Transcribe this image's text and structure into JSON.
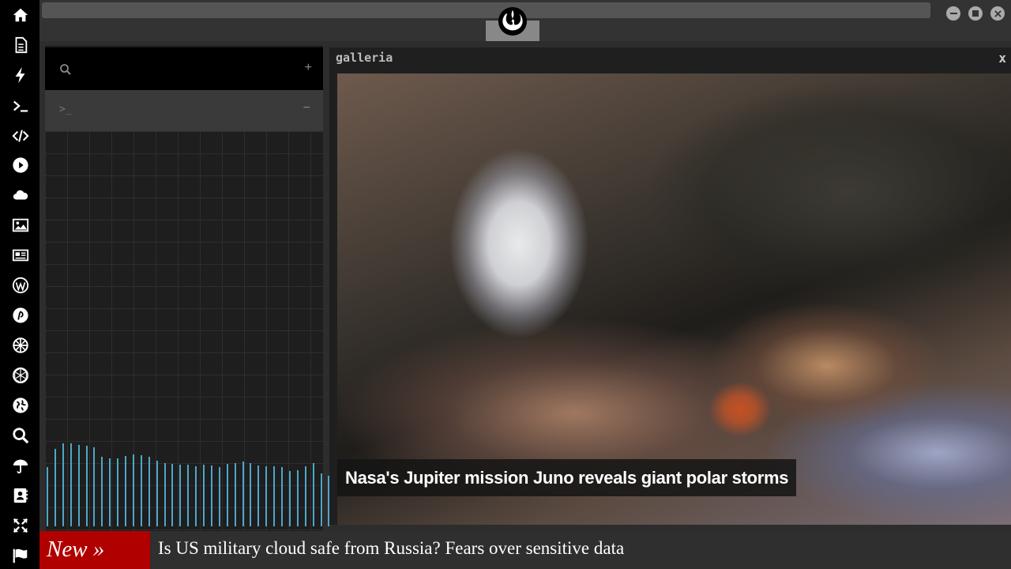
{
  "dock": {
    "items": [
      {
        "name": "home-icon"
      },
      {
        "name": "document-icon"
      },
      {
        "name": "lightning-icon"
      },
      {
        "name": "terminal-icon"
      },
      {
        "name": "code-icon"
      },
      {
        "name": "play-icon"
      },
      {
        "name": "cloud-icon"
      },
      {
        "name": "image-icon"
      },
      {
        "name": "newspaper-icon"
      },
      {
        "name": "wordpress-icon"
      },
      {
        "name": "pinterest-icon"
      },
      {
        "name": "empire-icon"
      },
      {
        "name": "geodesic-icon"
      },
      {
        "name": "globe-icon"
      },
      {
        "name": "search-icon"
      },
      {
        "name": "umbrella-icon"
      },
      {
        "name": "contact-icon"
      },
      {
        "name": "expand-icon"
      },
      {
        "name": "flag-icon"
      }
    ],
    "icon_color": "#ffffff"
  },
  "topbar": {
    "emblem": "rebel-alliance-icon"
  },
  "left_panel": {
    "add_label": "+",
    "terminal_prompt": ">_",
    "collapse_label": "−",
    "accent_color": "#4ea7c9"
  },
  "gallery": {
    "title": "galleria",
    "close_label": "x",
    "caption": "Nasa's Jupiter mission Juno reveals giant polar storms"
  },
  "ticker": {
    "label": "New »",
    "headline": "Is US military cloud safe from Russia? Fears over sensitive data",
    "label_color": "#b00000"
  }
}
